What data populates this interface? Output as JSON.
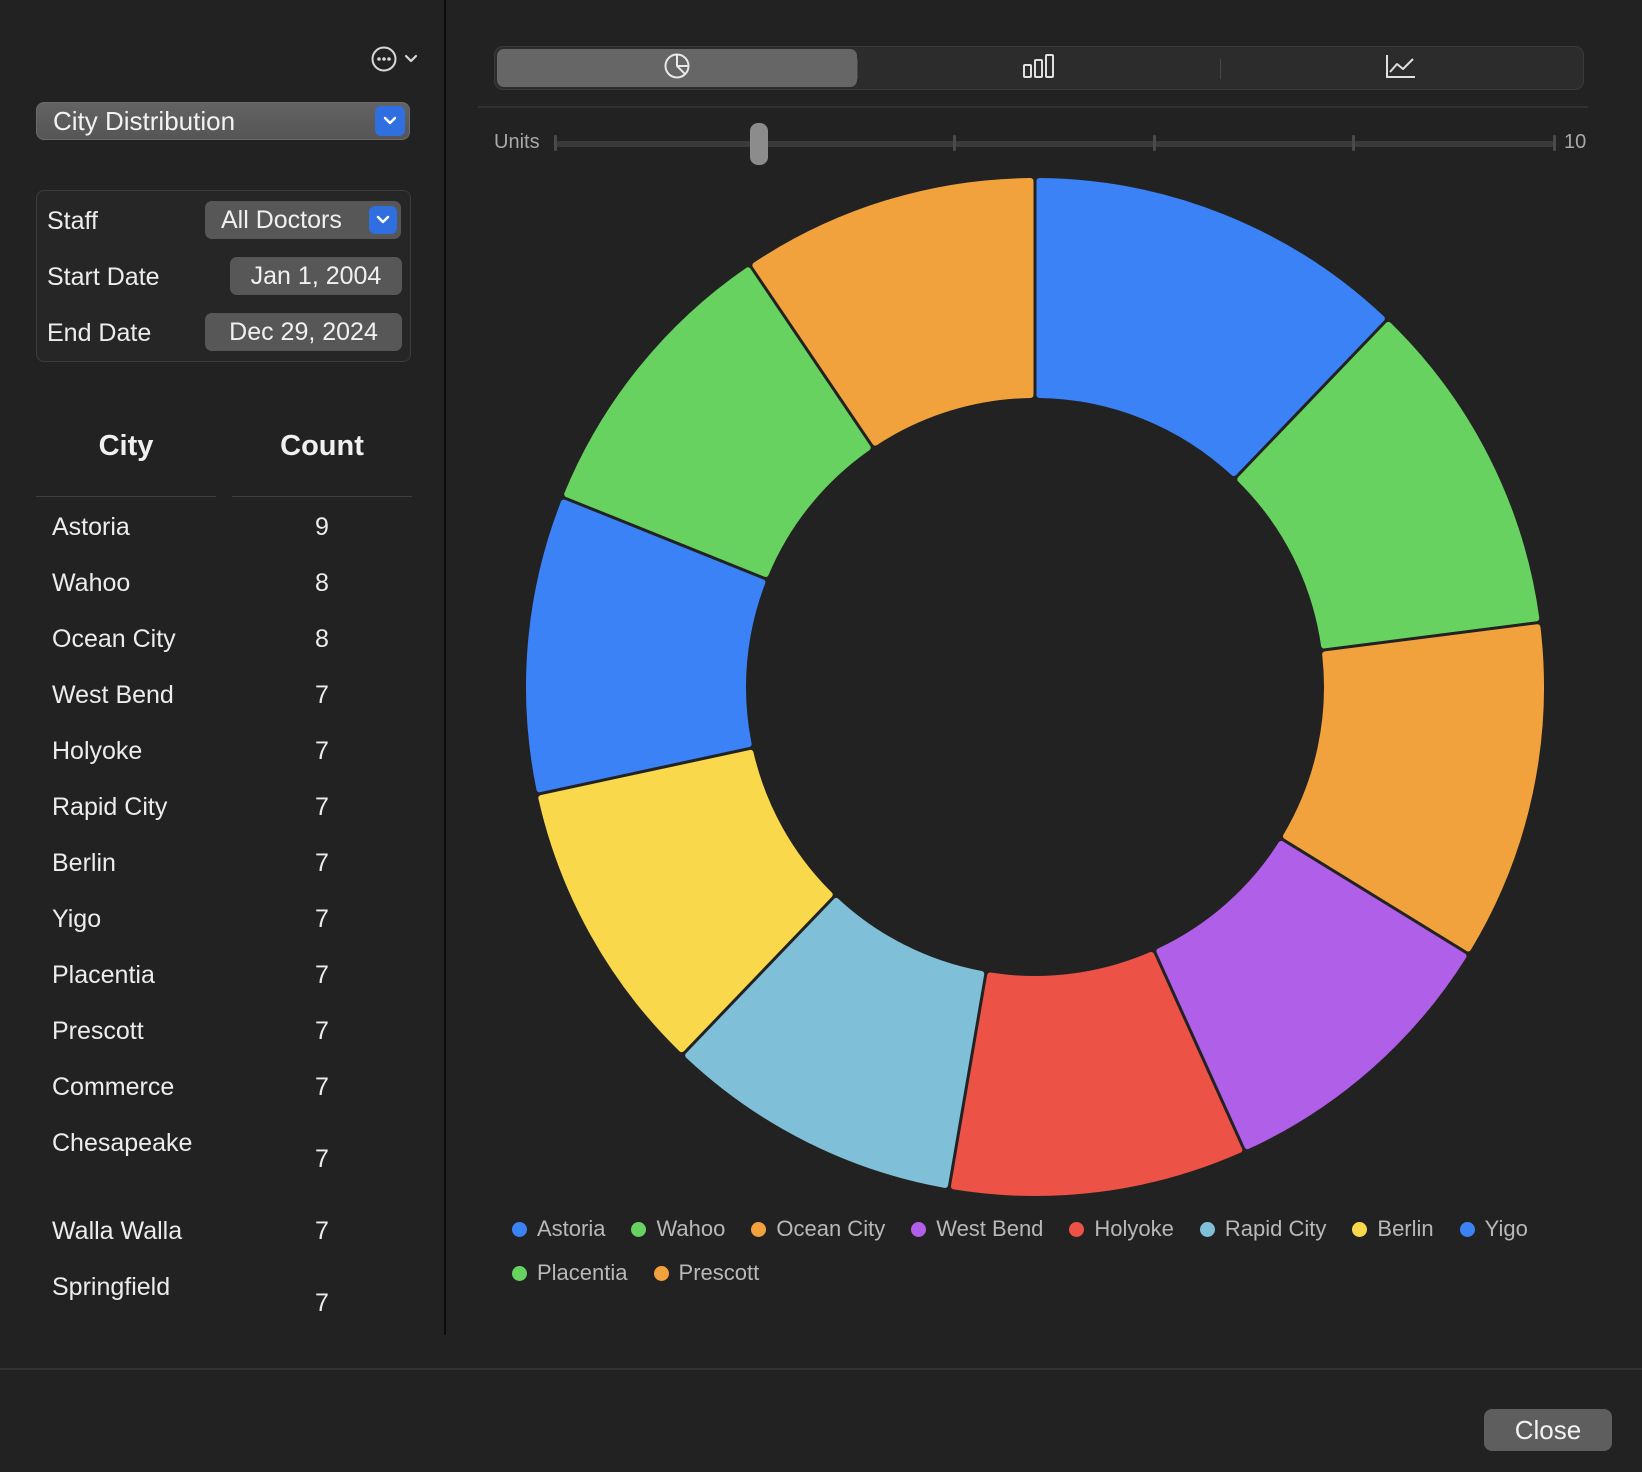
{
  "toolbar": {
    "more_icon": "ellipsis-circle-icon"
  },
  "report_select": {
    "value": "City Distribution"
  },
  "filters": {
    "staff_label": "Staff",
    "staff_value": "All Doctors",
    "start_label": "Start Date",
    "start_value": "Jan 1, 2004",
    "end_label": "End Date",
    "end_value": "Dec 29, 2024"
  },
  "table": {
    "headers": {
      "city": "City",
      "count": "Count"
    },
    "rows": [
      {
        "city": "Astoria",
        "count": "9"
      },
      {
        "city": "Wahoo",
        "count": "8"
      },
      {
        "city": "Ocean City",
        "count": "8"
      },
      {
        "city": "West Bend",
        "count": "7"
      },
      {
        "city": "Holyoke",
        "count": "7"
      },
      {
        "city": "Rapid City",
        "count": "7"
      },
      {
        "city": "Berlin",
        "count": "7"
      },
      {
        "city": "Yigo",
        "count": "7"
      },
      {
        "city": "Placentia",
        "count": "7"
      },
      {
        "city": "Prescott",
        "count": "7"
      },
      {
        "city": "Commerce",
        "count": "7"
      },
      {
        "city": "Chesapeake",
        "count": "7"
      },
      {
        "city": "Walla Walla",
        "count": "7"
      },
      {
        "city": "Springfield",
        "count": "7"
      }
    ]
  },
  "chart_tabs": {
    "selected": "pie",
    "icons": [
      "pie-chart-icon",
      "bar-chart-icon",
      "line-chart-icon"
    ]
  },
  "units_slider": {
    "label": "Units",
    "max_label": "10",
    "value": 2,
    "min": 1,
    "max": 10
  },
  "chart_data": {
    "type": "pie",
    "style": "donut",
    "categories": [
      "Astoria",
      "Wahoo",
      "Ocean City",
      "West Bend",
      "Holyoke",
      "Rapid City",
      "Berlin",
      "Yigo",
      "Placentia",
      "Prescott"
    ],
    "values": [
      9,
      8,
      8,
      7,
      7,
      7,
      7,
      7,
      7,
      7
    ],
    "colors": [
      "#3b82f6",
      "#67d25f",
      "#f2a23c",
      "#b05fe8",
      "#ec5245",
      "#7fc0d8",
      "#f9d84b",
      "#3b82f6",
      "#67d25f",
      "#f2a23c"
    ],
    "legend_position": "bottom"
  },
  "footer": {
    "close_label": "Close"
  }
}
